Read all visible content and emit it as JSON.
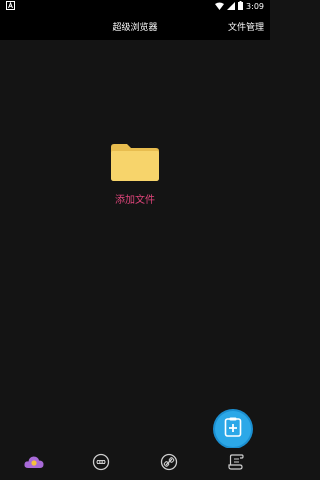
{
  "status_bar": {
    "time": "3:09",
    "icons": [
      "notification-a-icon",
      "wifi-icon",
      "signal-icon",
      "battery-icon"
    ]
  },
  "app_bar": {
    "title": "超级浏览器",
    "action_label": "文件管理"
  },
  "empty_state": {
    "icon": "folder-icon",
    "label": "添加文件",
    "label_color": "#e0457b",
    "folder_color": "#f7d46b"
  },
  "fab": {
    "icon": "add-file-icon",
    "color": "#2ca8e8"
  },
  "bottom_nav": {
    "items": [
      {
        "icon": "cloud-icon",
        "active": true
      },
      {
        "icon": "gamepad-icon",
        "active": false
      },
      {
        "icon": "link-icon",
        "active": false
      },
      {
        "icon": "scroll-icon",
        "active": false
      }
    ]
  }
}
